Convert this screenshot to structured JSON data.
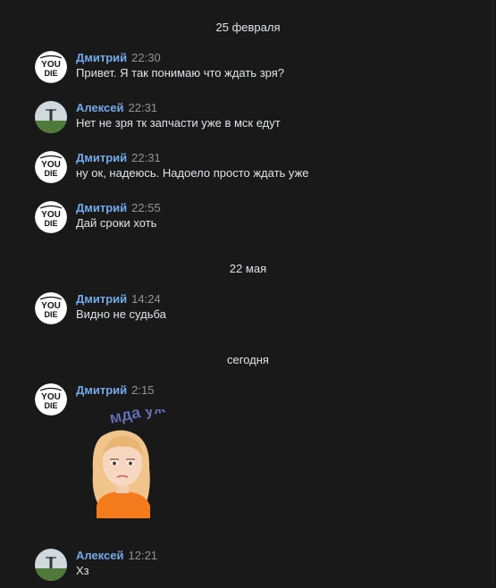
{
  "dates": [
    "25 февраля",
    "22 мая",
    "сегодня"
  ],
  "avatars": {
    "dmitry_text_top": "YOU",
    "dmitry_text_bottom": "DIE"
  },
  "messages": [
    {
      "author": "Дмитрий",
      "time": "22:30",
      "text": "Привет. Я так понимаю что ждать зря?"
    },
    {
      "author": "Алексей",
      "time": "22:31",
      "text": "Нет не зря тк запчасти уже в мск едут"
    },
    {
      "author": "Дмитрий",
      "time": "22:31",
      "text": "ну ок, надеюсь. Надоело просто ждать уже"
    },
    {
      "author": "Дмитрий",
      "time": "22:55",
      "text": "Дай сроки хоть"
    },
    {
      "author": "Дмитрий",
      "time": "14:24",
      "text": "Видно не судьба"
    },
    {
      "author": "Дмитрий",
      "time": "2:15",
      "text": ""
    },
    {
      "author": "Алексей",
      "time": "12:21",
      "text": "Хз"
    }
  ],
  "sticker": {
    "caption": "мда уж",
    "icon": "girl-sticker-icon"
  },
  "colors": {
    "background": "#191919",
    "author": "#71aaeb",
    "time": "#939393",
    "text": "#e1e3e6"
  }
}
